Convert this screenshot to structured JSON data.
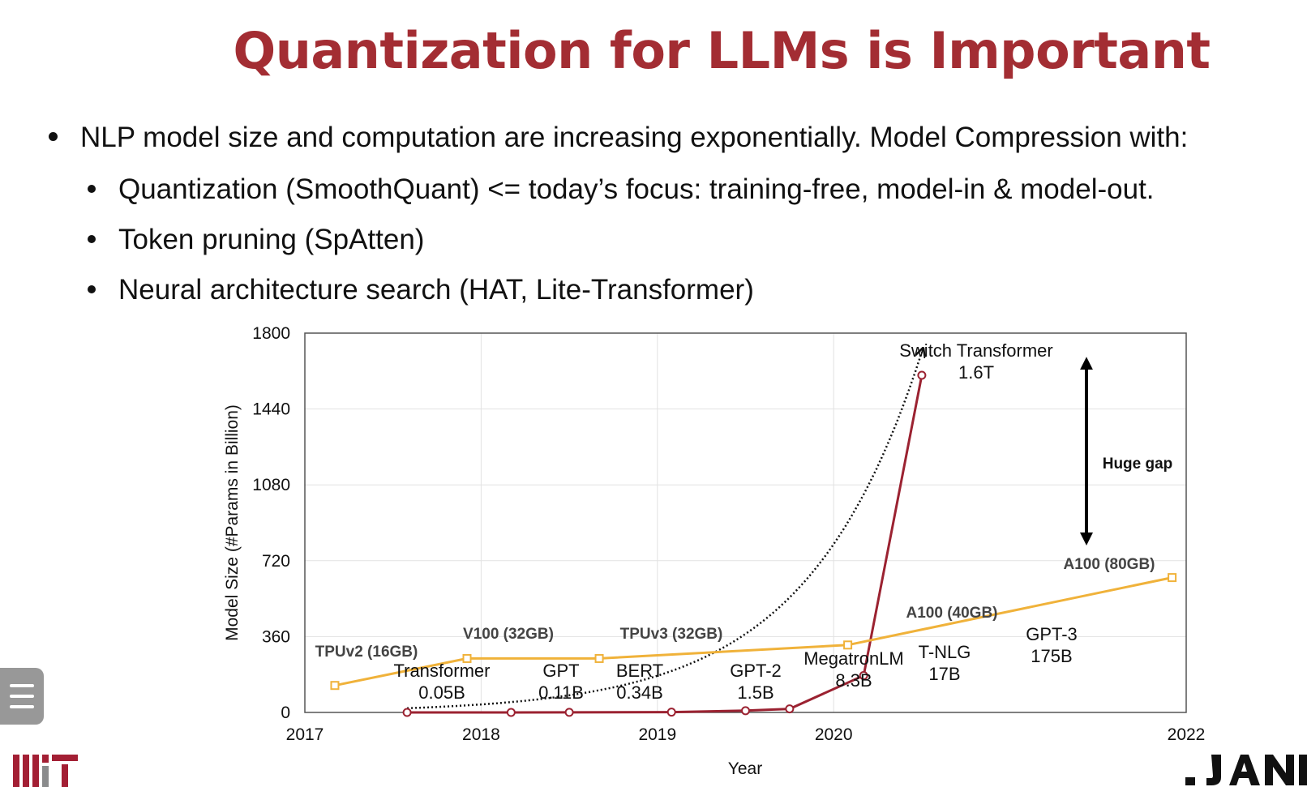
{
  "slide": {
    "title": "Quantization for LLMs is Important",
    "bullets": [
      {
        "level": 1,
        "text": "NLP model size and computation are increasing exponentially. Model Compression with:"
      },
      {
        "level": 2,
        "text": "Quantization (SmoothQuant) <= today’s focus: training-free, model-in & model-out."
      },
      {
        "level": 2,
        "text": "Token pruning (SpAtten)"
      },
      {
        "level": 2,
        "text": "Neural architecture search (HAT, Lite-Transformer)"
      }
    ]
  },
  "chart_data": {
    "type": "line",
    "title": "",
    "xlabel": "Year",
    "ylabel": "Model Size (#Params in Billion)",
    "xlim": [
      2017,
      2022
    ],
    "ylim": [
      0,
      1800
    ],
    "xticks": [
      2017,
      2018,
      2019,
      2020,
      2022
    ],
    "yticks": [
      0,
      360,
      720,
      1080,
      1440,
      1800
    ],
    "grid": true,
    "series": [
      {
        "key": "models",
        "color": "#9b2231",
        "marker": "circle",
        "points": [
          {
            "x": 2017.58,
            "y": 0.05,
            "label": [
              "Transformer",
              "0.05B"
            ]
          },
          {
            "x": 2018.17,
            "y": 0.11,
            "label": [
              "GPT",
              "0.11B"
            ]
          },
          {
            "x": 2018.5,
            "y": 0.34,
            "label": [
              "BERT",
              "0.34B"
            ]
          },
          {
            "x": 2019.08,
            "y": 1.5,
            "label": [
              "GPT-2",
              "1.5B"
            ]
          },
          {
            "x": 2019.5,
            "y": 8.3,
            "label": [
              "MegatronLM",
              "8.3B"
            ]
          },
          {
            "x": 2019.75,
            "y": 17,
            "label": [
              "T-NLG",
              "17B"
            ]
          },
          {
            "x": 2020.17,
            "y": 175,
            "label": [
              "GPT-3",
              "175B"
            ]
          },
          {
            "x": 2020.5,
            "y": 1600,
            "label": [
              "Switch Transformer",
              "1.6T"
            ]
          }
        ]
      },
      {
        "key": "gpu_memory",
        "color": "#f0b23a",
        "marker": "square",
        "points": [
          {
            "x": 2017.17,
            "y": 128,
            "label": [
              "TPUv2 (16GB)"
            ]
          },
          {
            "x": 2017.92,
            "y": 256,
            "label": [
              "V100 (32GB)"
            ]
          },
          {
            "x": 2018.67,
            "y": 256,
            "label": [
              "TPUv3 (32GB)"
            ]
          },
          {
            "x": 2020.08,
            "y": 320,
            "label": [
              "A100 (40GB)"
            ]
          },
          {
            "x": 2021.92,
            "y": 640,
            "label": [
              "A100 (80GB)"
            ]
          }
        ]
      }
    ],
    "trend": {
      "style": "dotted",
      "color": "#111111",
      "from": [
        2017.58,
        20
      ],
      "to": [
        2020.5,
        1710
      ]
    },
    "annotation": {
      "text": "Huge gap",
      "from_y": 1680,
      "to_y": 800
    }
  },
  "icons": {
    "menu": "menu-icon",
    "logo_left": "mit-logo",
    "logo_right": "han-lab-logo"
  }
}
